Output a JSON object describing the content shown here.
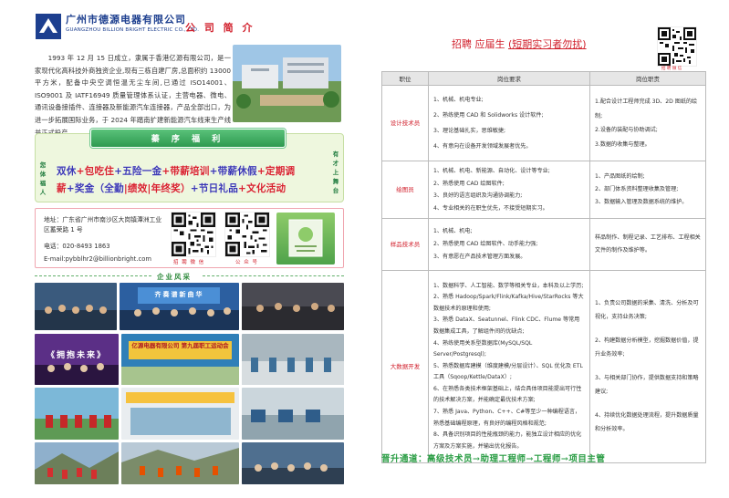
{
  "header": {
    "company_cn": "广州市德源电器有限公司",
    "company_en": "GUANGZHOU BILLION BRIGHT ELECTRIC CO., LTD.",
    "intro_title": "公 司 简 介"
  },
  "intro": {
    "text": "1993 年 12 月 15 日成立，隶属于香港亿源有限公司，是一家现代化高科技外商独资企业,现有三栋自建厂房,总面积约 13000 平方米，配备中央空调恒温无尘车间,已通过 ISO14001、ISO9001 及 IATF16949 质量管理体系认证，主营电器、微电、通讯设备接插件、连接器及新能源汽车连接器，产品全部出口，为进一步拓展国际业务，于 2024 年踏南扩建新能源汽车线束生产线并正式投产。"
  },
  "benefits": {
    "banner": "蓁 序 福 利",
    "side_left": "您 体 福 人",
    "side_right": "有 才 上 舞 台",
    "line1": [
      {
        "text": "双休",
        "hl": false
      },
      {
        "text": "+包吃住",
        "hl": true
      },
      {
        "text": "+五险一金",
        "hl": false
      },
      {
        "text": "+带薪培训",
        "hl": true
      },
      {
        "text": "+带薪休假",
        "hl": false
      },
      {
        "text": "+定期调",
        "hl": true
      }
    ],
    "line2": [
      {
        "text": "薪",
        "hl": true
      },
      {
        "text": "+奖金（全勤",
        "hl": false
      },
      {
        "text": "|绩效|年终奖）",
        "hl": true
      },
      {
        "text": "+节日礼品",
        "hl": false
      },
      {
        "text": "+文化活动",
        "hl": true
      }
    ]
  },
  "contact": {
    "address": "地址：广东省广州市南沙区大岗镇潭洲工业区蓄荣路 1 号",
    "phone": "电话：020-8493 1863",
    "email": "E-mail:pybblhr2@billionbright.com",
    "qr_recruit_label": "招 聘 微 信",
    "qr_public_label": "公 众 号"
  },
  "gallery": {
    "title": "企业风采",
    "banner_2": "齐奏谱新曲华",
    "banner_4": "《拥抱未来》",
    "banner_5": "亿源电器有限公司 第九届职工运动会"
  },
  "recruit": {
    "title_prefix": "招聘 应届生",
    "title_underlined": "(短期实习者勿扰)",
    "qr_label": "招 聘 微 信",
    "headers": [
      "职位",
      "岗位要求",
      "岗位职责"
    ],
    "rows": [
      {
        "position": "设计技术员",
        "requirements": [
          "1、机械、机电专业;",
          "2、熟练使用 CAD 和 Solidworks 设计软件;",
          "3、理论基础扎实，思维敏捷;",
          "4、有意向在设备开发领域发展者优先。"
        ],
        "duties": [
          "1.配合设计工程师完成 3D、2D 图纸的绘制;",
          "2.设备的装配与协助调试;",
          "3.数据的收集与整理。"
        ]
      },
      {
        "position": "绘图员",
        "requirements": [
          "1、机械、机电、新能源、自动化、设计等专业;",
          "2、熟悉使用 CAD 绘图软件;",
          "3、良好的语言组织及沟通协调能力;",
          "4、专业相关的在职生优先，不接受短期实习。"
        ],
        "duties": [
          "1、产品图纸的绘制;",
          "2、部门体系资料整理收集及管理;",
          "3、数据输入管理及数据系统的维护。"
        ]
      },
      {
        "position": "样品技术员",
        "requirements": [
          "1、机械、机电;",
          "2、熟悉使用 CAD 绘图软件、动手能力强;",
          "3、有意愿在产品技术管理方面发展。"
        ],
        "duties": [
          "样品制作、制程记录、工艺排布、工程相关文件的制作及维护等。"
        ]
      },
      {
        "position": "大数据开发",
        "requirements": [
          "1、数据科学、人工智能、数学等相关专业，本科及以上学历;",
          "2、熟悉 Hadoop/Spark/Flink/Kafka/Hive/StarRocks 等大数据技术的原理和使用;",
          "3、熟悉 DataX、Seatunnel、Flink CDC、Flume 等常用数据集成工具，了解组件间的优缺点;",
          "4、熟练使用关系型数据库(MySQL/SQL Server/Postgresql);",
          "5、熟悉数据库建模（维度建模/分层设计）、SQL 优化及 ETL 工具（Sqoop/Kettle/DataX）;",
          "6、在熟悉各类技术框架基础上，结合具体项目能提出可行性的技术解决方案，并能确定最优技术方案;",
          "7、熟悉 Java、Python、C++、C#等至少一种编程语言，熟悉基础编程原理，有良好的编程风格和规范;",
          "8、具备识别项目的性能瓶颈的能力，能独立设计相应的优化方案及方案实施，并输出优化报告。"
        ],
        "duties": [
          "1、负责公司数据的采集、清洗、分析及可视化，支持业务决策;",
          "2、构建数据分析模型，挖掘数据价值，提升业务效率;",
          "3、与相关部门协作，提供数据支持和策略建议;",
          "4、持续优化数据处理流程，提升数据质量和分析效率。"
        ]
      }
    ],
    "career_path": "晋升通道：高级技术员→助理工程师→工程师→项目主管"
  },
  "colors": {
    "brand_blue": "#1d3f8f",
    "accent_red": "#d11f2b",
    "green": "#2a9d44"
  }
}
